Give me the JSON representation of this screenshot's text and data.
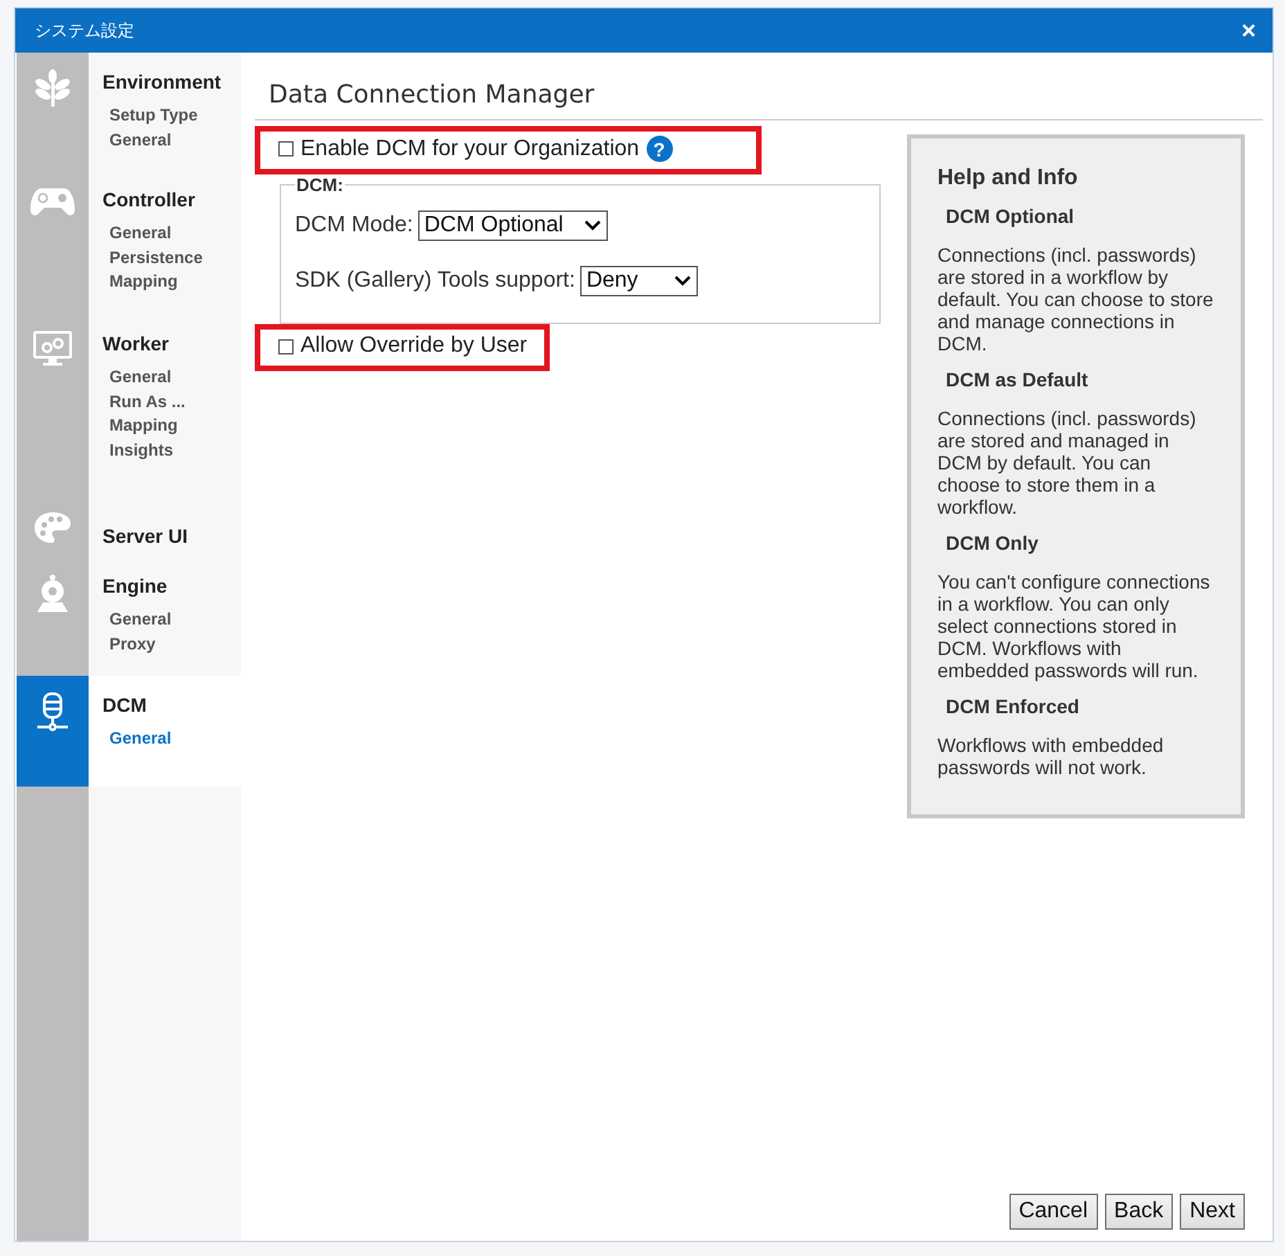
{
  "window": {
    "title": "システム設定",
    "close": "×"
  },
  "sidebar": {
    "sections": [
      {
        "kind": "leaf",
        "title": "Environment",
        "selected": false,
        "items": [
          {
            "label": "Setup Type",
            "selected": false
          },
          {
            "label": "General",
            "selected": false
          }
        ]
      },
      {
        "kind": "gamepad",
        "title": "Controller",
        "selected": false,
        "items": [
          {
            "label": "General",
            "selected": false
          },
          {
            "label": "Persistence",
            "selected": false
          },
          {
            "label": "Mapping",
            "selected": false
          }
        ]
      },
      {
        "kind": "monitor",
        "title": "Worker",
        "selected": false,
        "items": [
          {
            "label": "General",
            "selected": false
          },
          {
            "label": "Run As ...",
            "selected": false
          },
          {
            "label": "Mapping",
            "selected": false
          },
          {
            "label": "Insights",
            "selected": false
          }
        ]
      },
      {
        "kind": "palette",
        "title": "Server UI",
        "selected": false
      },
      {
        "kind": "engine",
        "title": "Engine",
        "selected": false,
        "items": [
          {
            "label": "General",
            "selected": false
          },
          {
            "label": "Proxy",
            "selected": false
          }
        ]
      },
      {
        "kind": "database",
        "title": "DCM",
        "selected": true,
        "items": [
          {
            "label": "General",
            "selected": true
          }
        ]
      }
    ]
  },
  "heading": "Data Connection Manager",
  "enable_dcm": {
    "label": "Enable DCM for your Organization",
    "checked": false,
    "highlighted": true,
    "help": "?"
  },
  "dcm_group": {
    "legend": "DCM:",
    "fields": [
      {
        "label": "DCM Mode:",
        "value": "DCM Optional"
      },
      {
        "label": "SDK (Gallery) Tools support:",
        "value": "Deny"
      }
    ]
  },
  "allow_override": {
    "label": "Allow Override by User",
    "checked": false,
    "highlighted": true
  },
  "help_panel": {
    "title": "Help and Info",
    "topics": [
      {
        "title": "DCM Optional",
        "text": "Connections (incl. passwords) are stored in a workflow by default. You can choose to store and manage connections in DCM."
      },
      {
        "title": "DCM as Default",
        "text": "Connections (incl. passwords) are stored and managed in DCM by default. You can choose to store them in a workflow."
      },
      {
        "title": "DCM Only",
        "text": "You can't configure connections in a workflow. You can only select connections stored in DCM. Workflows with embedded passwords will run."
      },
      {
        "title": "DCM Enforced",
        "text": "Workflows with embedded passwords will not work."
      }
    ]
  },
  "buttons": [
    "Cancel",
    "Back",
    "Next"
  ]
}
